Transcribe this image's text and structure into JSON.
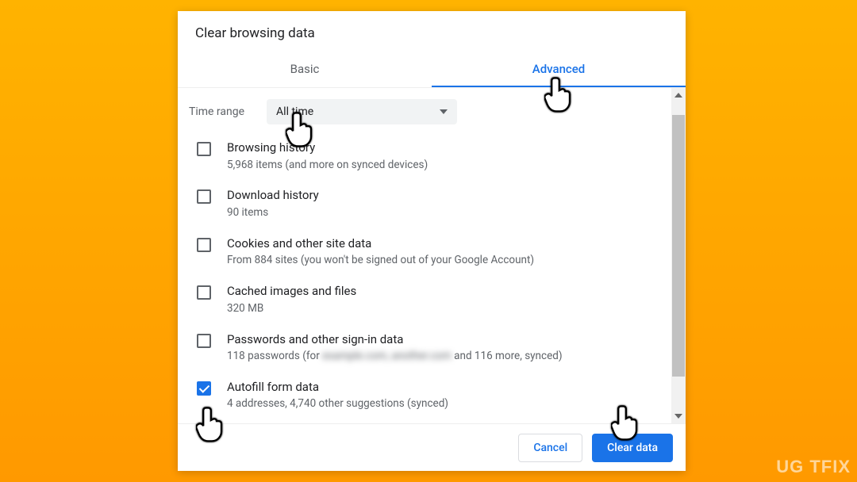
{
  "dialog": {
    "title": "Clear browsing data",
    "tabs": {
      "basic": "Basic",
      "advanced": "Advanced"
    },
    "time_range": {
      "label": "Time range",
      "selected": "All time"
    },
    "items": [
      {
        "title": "Browsing history",
        "sub": "5,968 items (and more on synced devices)",
        "checked": false
      },
      {
        "title": "Download history",
        "sub": "90 items",
        "checked": false
      },
      {
        "title": "Cookies and other site data",
        "sub": "From 884 sites (you won't be signed out of your Google Account)",
        "checked": false
      },
      {
        "title": "Cached images and files",
        "sub": "320 MB",
        "checked": false
      },
      {
        "title": "Passwords and other sign-in data",
        "sub_prefix": "118 passwords (for",
        "sub_blur": "example.com, another.com",
        "sub_suffix": "and 116 more, synced)",
        "checked": false
      },
      {
        "title": "Autofill form data",
        "sub": "4 addresses, 4,740 other suggestions (synced)",
        "checked": true
      }
    ],
    "buttons": {
      "cancel": "Cancel",
      "confirm": "Clear data"
    }
  },
  "watermark": "UG  TFIX"
}
